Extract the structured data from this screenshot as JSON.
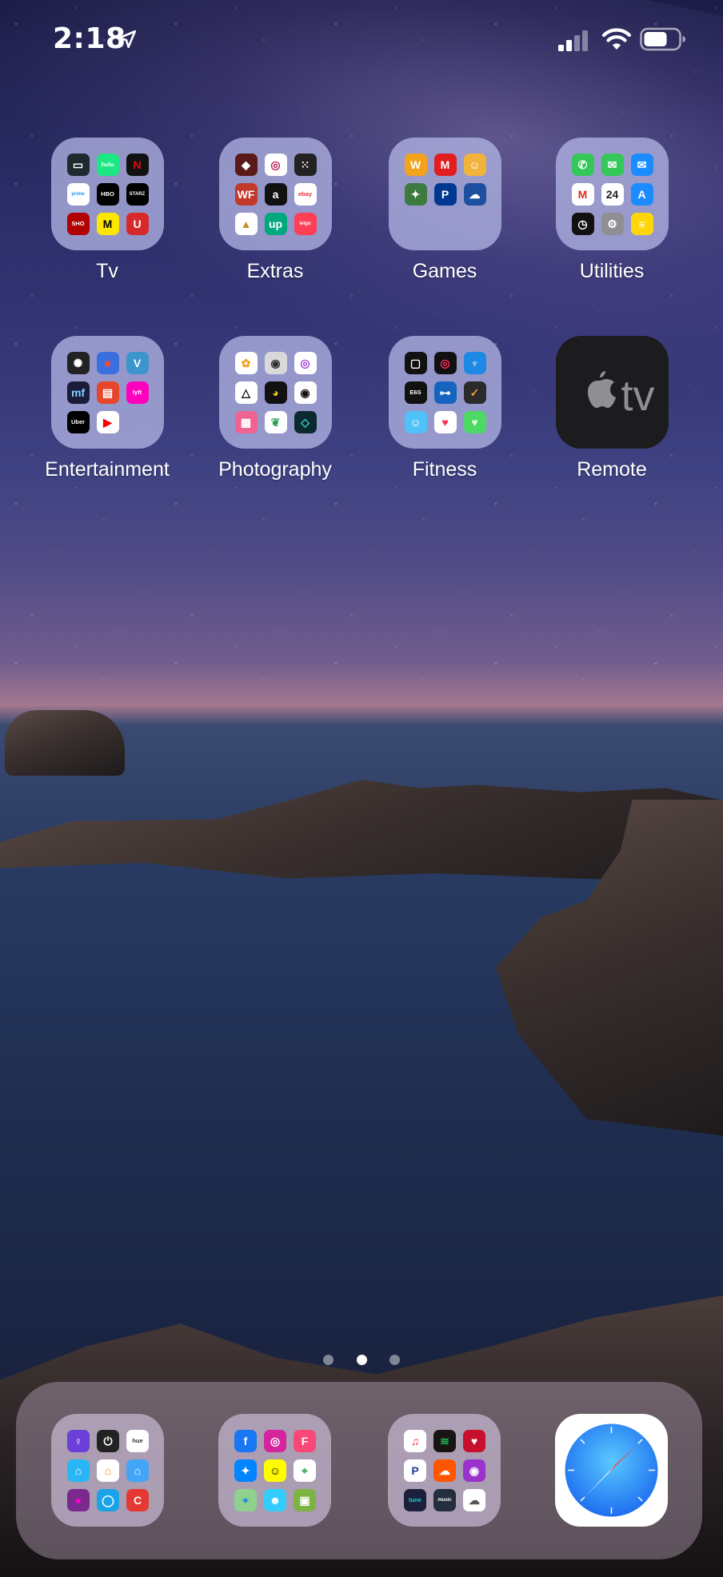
{
  "status_bar": {
    "time": "2:18"
  },
  "home_screen": {
    "row1": [
      {
        "label": "Tv",
        "type": "folder",
        "minis": [
          {
            "icon": "tv-app-icon",
            "bg": "#1f2a2f",
            "text": "▭"
          },
          {
            "icon": "hulu-icon",
            "bg": "#1ce783",
            "text": "hulu"
          },
          {
            "icon": "netflix-icon",
            "bg": "#111111",
            "text": "N",
            "color": "#e50914"
          },
          {
            "icon": "prime-video-icon",
            "bg": "#ffffff",
            "text": "prime",
            "color": "#1a98ff"
          },
          {
            "icon": "hbo-go-icon",
            "bg": "#000000",
            "text": "HBO"
          },
          {
            "icon": "starz-icon",
            "bg": "#000000",
            "text": "STARZ"
          },
          {
            "icon": "showtime-icon",
            "bg": "#b10000",
            "text": "SHO"
          },
          {
            "icon": "mtv-icon",
            "bg": "#ffe600",
            "text": "M",
            "color": "#000000"
          },
          {
            "icon": "usa-icon",
            "bg": "#d62a2a",
            "text": "U"
          }
        ]
      },
      {
        "label": "Extras",
        "type": "folder",
        "minis": [
          {
            "icon": "shield-app-icon",
            "bg": "#5a1a1a",
            "text": "◆"
          },
          {
            "icon": "steering-wheel-icon",
            "bg": "#ffffff",
            "text": "◎",
            "color": "#c2185b"
          },
          {
            "icon": "dice-icon",
            "bg": "#222222",
            "text": "⁙"
          },
          {
            "icon": "wf-icon",
            "bg": "#c0392b",
            "text": "WF"
          },
          {
            "icon": "amazon-icon",
            "bg": "#111111",
            "text": "a"
          },
          {
            "icon": "ebay-icon",
            "bg": "#ffffff",
            "text": "ebay",
            "color": "#e53238"
          },
          {
            "icon": "triangle-app-icon",
            "bg": "#ffffff",
            "text": "▲",
            "color": "#c8902a"
          },
          {
            "icon": "offerup-icon",
            "bg": "#00a87e",
            "text": "up"
          },
          {
            "icon": "letgo-icon",
            "bg": "#ff3f55",
            "text": "letgo"
          }
        ]
      },
      {
        "label": "Games",
        "type": "folder",
        "minis": [
          {
            "icon": "words-icon",
            "bg": "#f3a31c",
            "text": "W"
          },
          {
            "icon": "mario-icon",
            "bg": "#e21d1d",
            "text": "M"
          },
          {
            "icon": "cartoon-game-icon",
            "bg": "#f2b33d",
            "text": "☺"
          },
          {
            "icon": "action-game-icon",
            "bg": "#3d7a3d",
            "text": "✦"
          },
          {
            "icon": "playstation-icon",
            "bg": "#003791",
            "text": "P"
          },
          {
            "icon": "chat-game-icon",
            "bg": "#1c4fa0",
            "text": "☁"
          }
        ]
      },
      {
        "label": "Utilities",
        "type": "folder",
        "minis": [
          {
            "icon": "phone-icon",
            "bg": "#34c759",
            "text": "✆"
          },
          {
            "icon": "messages-icon",
            "bg": "#34c759",
            "text": "✉"
          },
          {
            "icon": "mail-icon",
            "bg": "#1a8cff",
            "text": "✉"
          },
          {
            "icon": "gmail-icon",
            "bg": "#ffffff",
            "text": "M",
            "color": "#d93025"
          },
          {
            "icon": "calendar-icon",
            "bg": "#ffffff",
            "text": "24",
            "color": "#222222"
          },
          {
            "icon": "app-store-icon",
            "bg": "#1a8cff",
            "text": "A"
          },
          {
            "icon": "clock-icon",
            "bg": "#111111",
            "text": "◷"
          },
          {
            "icon": "settings-gear-icon",
            "bg": "#8e8e93",
            "text": "⚙"
          },
          {
            "icon": "notes-icon",
            "bg": "#ffd60a",
            "text": "≡",
            "color": "#ffffff"
          }
        ]
      }
    ],
    "row2": [
      {
        "label": "Entertainment",
        "type": "folder",
        "minis": [
          {
            "icon": "film-reel-icon",
            "bg": "#222222",
            "text": "✺"
          },
          {
            "icon": "flag-app-icon",
            "bg": "#3b6fe0",
            "text": "■",
            "color": "#e94b3c"
          },
          {
            "icon": "venmo-icon",
            "bg": "#3d95ce",
            "text": "V"
          },
          {
            "icon": "mf-icon",
            "bg": "#1c1c3a",
            "text": "mf",
            "color": "#7bd3ff"
          },
          {
            "icon": "ticket-icon",
            "bg": "#e8462b",
            "text": "▤"
          },
          {
            "icon": "lyft-icon",
            "bg": "#ff00bf",
            "text": "lyft"
          },
          {
            "icon": "uber-icon",
            "bg": "#000000",
            "text": "Uber"
          },
          {
            "icon": "youtube-icon",
            "bg": "#ffffff",
            "text": "▶",
            "color": "#ff0000"
          }
        ]
      },
      {
        "label": "Photography",
        "type": "folder",
        "minis": [
          {
            "icon": "photos-icon",
            "bg": "#ffffff",
            "text": "✿",
            "color": "#f4a11a"
          },
          {
            "icon": "camera-icon",
            "bg": "#d9d9d9",
            "text": "◉",
            "color": "#333333"
          },
          {
            "icon": "aperture-icon",
            "bg": "#ffffff",
            "text": "◎",
            "color": "#a33fd8"
          },
          {
            "icon": "darkroom-icon",
            "bg": "#ffffff",
            "text": "△",
            "color": "#111111"
          },
          {
            "icon": "color-wheel-icon",
            "bg": "#111111",
            "text": "◕",
            "color": "#f1c40f"
          },
          {
            "icon": "lens-icon",
            "bg": "#ffffff",
            "text": "◉",
            "color": "#111111"
          },
          {
            "icon": "layout-icon",
            "bg": "#f06292",
            "text": "▦"
          },
          {
            "icon": "snapseed-icon",
            "bg": "#ffffff",
            "text": "❦",
            "color": "#2e9e4f"
          },
          {
            "icon": "prism-icon",
            "bg": "#0b2a30",
            "text": "◇",
            "color": "#38d0c8"
          }
        ]
      },
      {
        "label": "Fitness",
        "type": "folder",
        "minis": [
          {
            "icon": "watch-icon",
            "bg": "#111111",
            "text": "▢"
          },
          {
            "icon": "activity-icon",
            "bg": "#111111",
            "text": "◎",
            "color": "#ff2d55"
          },
          {
            "icon": "tooth-icon",
            "bg": "#1e88e5",
            "text": "♆"
          },
          {
            "icon": "e6s-icon",
            "bg": "#111111",
            "text": "E6S"
          },
          {
            "icon": "dumbbell-icon",
            "bg": "#1565c0",
            "text": "⊶"
          },
          {
            "icon": "nike-icon",
            "bg": "#2b2b2b",
            "text": "✓",
            "color": "#e6a23c"
          },
          {
            "icon": "kid-app-icon",
            "bg": "#4fc3f7",
            "text": "☺"
          },
          {
            "icon": "health-icon",
            "bg": "#ffffff",
            "text": "♥",
            "color": "#ff2d55"
          },
          {
            "icon": "heart-app-icon",
            "bg": "#4cd964",
            "text": "♥",
            "color": "#d8ffe0"
          }
        ]
      },
      {
        "label": "Remote",
        "type": "app",
        "icon_name": "apple-tv-remote-icon",
        "icon_text": "tv",
        "icon_bg": "#1c1c1e"
      }
    ]
  },
  "page_indicator": {
    "count": 3,
    "active_index": 1
  },
  "dock": {
    "folder1": {
      "minis": [
        {
          "icon": "lightbulb-app-icon",
          "bg": "#6b3fd8",
          "text": "♀"
        },
        {
          "icon": "power-icon",
          "bg": "#222222",
          "text": "⏻"
        },
        {
          "icon": "hue-icon",
          "bg": "#ffffff",
          "text": "hue",
          "color": "#333333"
        },
        {
          "icon": "home-blue-icon",
          "bg": "#29b6f6",
          "text": "⌂"
        },
        {
          "icon": "home-orange-icon",
          "bg": "#ffffff",
          "text": "⌂",
          "color": "#fb8c00"
        },
        {
          "icon": "home-light-blue-icon",
          "bg": "#42a5f5",
          "text": "⌂"
        },
        {
          "icon": "orb-icon",
          "bg": "#7a2a8f",
          "text": "●",
          "color": "#f0c"
        },
        {
          "icon": "alexa-icon",
          "bg": "#1aa3e8",
          "text": "◯"
        },
        {
          "icon": "pac-icon",
          "bg": "#e53935",
          "text": "C"
        }
      ]
    },
    "folder2": {
      "minis": [
        {
          "icon": "facebook-icon",
          "bg": "#1877f2",
          "text": "f"
        },
        {
          "icon": "instagram-icon",
          "bg": "#d6249f",
          "text": "◎"
        },
        {
          "icon": "foursquare-icon",
          "bg": "#f94877",
          "text": "F"
        },
        {
          "icon": "messenger-icon",
          "bg": "#0084ff",
          "text": "✦"
        },
        {
          "icon": "snapchat-icon",
          "bg": "#fffc00",
          "text": "☺",
          "color": "#000000"
        },
        {
          "icon": "google-maps-icon",
          "bg": "#ffffff",
          "text": "⌖",
          "color": "#34a853"
        },
        {
          "icon": "maps-icon",
          "bg": "#8fd18f",
          "text": "⌖",
          "color": "#1e88e5"
        },
        {
          "icon": "waze-icon",
          "bg": "#33ccff",
          "text": "☻"
        },
        {
          "icon": "android-app-icon",
          "bg": "#7cb342",
          "text": "▣"
        }
      ]
    },
    "folder3": {
      "minis": [
        {
          "icon": "music-icon",
          "bg": "#ffffff",
          "text": "♫",
          "color": "#fa2d48"
        },
        {
          "icon": "spotify-icon",
          "bg": "#191414",
          "text": "≋",
          "color": "#1db954"
        },
        {
          "icon": "iheart-icon",
          "bg": "#c8102e",
          "text": "♥"
        },
        {
          "icon": "pandora-icon",
          "bg": "#ffffff",
          "text": "P",
          "color": "#224099"
        },
        {
          "icon": "soundcloud-icon",
          "bg": "#ff5500",
          "text": "☁"
        },
        {
          "icon": "podcasts-icon",
          "bg": "#9933cc",
          "text": "◉"
        },
        {
          "icon": "tunein-icon",
          "bg": "#1c203c",
          "text": "tune",
          "color": "#14d8cc"
        },
        {
          "icon": "amazon-music-icon",
          "bg": "#232f3e",
          "text": "music"
        },
        {
          "icon": "cloud-icon",
          "bg": "#ffffff",
          "text": "☁",
          "color": "#555555"
        }
      ]
    },
    "safari": {
      "icon_name": "safari-icon"
    }
  }
}
